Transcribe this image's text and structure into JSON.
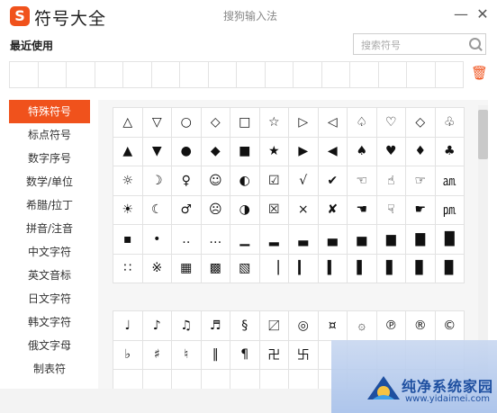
{
  "window": {
    "logo_char": "S",
    "title": "符号大全",
    "subtitle": "搜狗输入法",
    "minimize": "—",
    "close": "✕"
  },
  "recent": {
    "title": "最近使用",
    "slots": 16
  },
  "search": {
    "placeholder": "搜索符号"
  },
  "sidebar": {
    "items": [
      {
        "label": "特殊符号",
        "active": true
      },
      {
        "label": "标点符号"
      },
      {
        "label": "数字序号"
      },
      {
        "label": "数学/单位"
      },
      {
        "label": "希腊/拉丁"
      },
      {
        "label": "拼音/注音"
      },
      {
        "label": "中文字符"
      },
      {
        "label": "英文音标"
      },
      {
        "label": "日文字符"
      },
      {
        "label": "韩文字符"
      },
      {
        "label": "俄文字母"
      },
      {
        "label": "制表符"
      }
    ]
  },
  "symbols_main": [
    "△",
    "▽",
    "○",
    "◇",
    "□",
    "☆",
    "▷",
    "◁",
    "♤",
    "♡",
    "◇",
    "♧",
    "▲",
    "▼",
    "●",
    "◆",
    "■",
    "★",
    "▶",
    "◀",
    "♠",
    "♥",
    "♦",
    "♣",
    "☼",
    "☽",
    "♀",
    "☺",
    "◐",
    "☑",
    "√",
    "✔",
    "☜",
    "☝",
    "☞",
    "㏂",
    "☀",
    "☾",
    "♂",
    "☹",
    "◑",
    "☒",
    "×",
    "✘",
    "☚",
    "☟",
    "☛",
    "㏘",
    "▪",
    "•",
    "‥",
    "…",
    "▁",
    "▂",
    "▃",
    "▄",
    "▅",
    "▆",
    "▇",
    "█",
    "∷",
    "※",
    "▦",
    "▩",
    "▧",
    "▕",
    "▎",
    "▍",
    "▌",
    "▋",
    "▊",
    "▉"
  ],
  "symbols_second": [
    "♩",
    "♪",
    "♫",
    "♬",
    "§",
    "〼",
    "◎",
    "¤",
    "۞",
    "℗",
    "®",
    "©",
    "♭",
    "♯",
    "♮",
    "‖",
    "¶",
    "卍",
    "卐",
    "",
    "",
    "",
    "",
    "",
    "",
    "",
    "",
    "",
    "",
    "",
    "",
    "",
    "",
    "",
    "",
    ""
  ],
  "watermark": {
    "text": "纯净系统家园",
    "url": "www.yidaimei.com"
  }
}
